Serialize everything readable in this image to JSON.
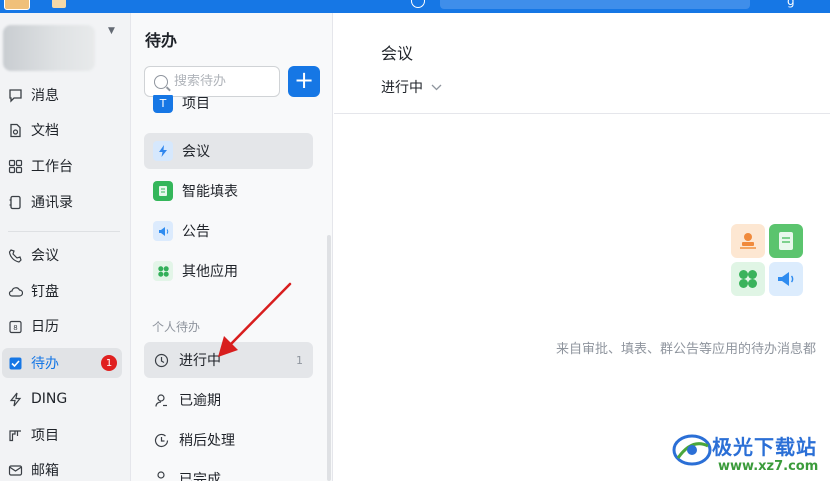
{
  "topbar": {},
  "leftnav": {
    "items": [
      {
        "label": "消息",
        "icon": "message-icon"
      },
      {
        "label": "文档",
        "icon": "document-icon"
      },
      {
        "label": "工作台",
        "icon": "workbench-icon"
      },
      {
        "label": "通讯录",
        "icon": "contacts-icon"
      },
      {
        "label": "会议",
        "icon": "phone-icon"
      },
      {
        "label": "钉盘",
        "icon": "cloud-icon"
      },
      {
        "label": "日历",
        "icon": "calendar-icon"
      },
      {
        "label": "待办",
        "icon": "checkbox-icon",
        "badge": "1",
        "active": true
      },
      {
        "label": "DING",
        "icon": "lightning-icon"
      },
      {
        "label": "项目",
        "icon": "project-icon"
      },
      {
        "label": "邮箱",
        "icon": "mail-icon"
      }
    ]
  },
  "midpanel": {
    "title": "待办",
    "search_placeholder": "搜索待办",
    "categories": [
      {
        "label": "项目",
        "icon": "project-app-icon",
        "color": "#1677e5"
      },
      {
        "label": "会议",
        "icon": "meeting-app-icon",
        "color": "#3b8cf0",
        "active": true
      },
      {
        "label": "智能填表",
        "icon": "form-app-icon",
        "color": "#34b65a"
      },
      {
        "label": "公告",
        "icon": "announcement-app-icon",
        "color": "#2f8cf0"
      },
      {
        "label": "其他应用",
        "icon": "other-apps-icon",
        "color": "#33b05a"
      }
    ],
    "section_label": "个人待办",
    "statuses": [
      {
        "label": "进行中",
        "icon": "clock-icon",
        "count": "1",
        "active": true
      },
      {
        "label": "已逾期",
        "icon": "person-icon"
      },
      {
        "label": "稍后处理",
        "icon": "clock-later-icon"
      },
      {
        "label": "已完成",
        "icon": "person-done-icon"
      }
    ]
  },
  "content": {
    "title": "会议",
    "filter_label": "进行中",
    "empty_text": "来自审批、填表、群公告等应用的待办消息都"
  },
  "watermark": {
    "text": "极光下载站",
    "url": "www.xz7.com"
  },
  "colors": {
    "accent": "#1677e5",
    "badge": "#e02020",
    "annotation_arrow": "#d81e1e"
  }
}
